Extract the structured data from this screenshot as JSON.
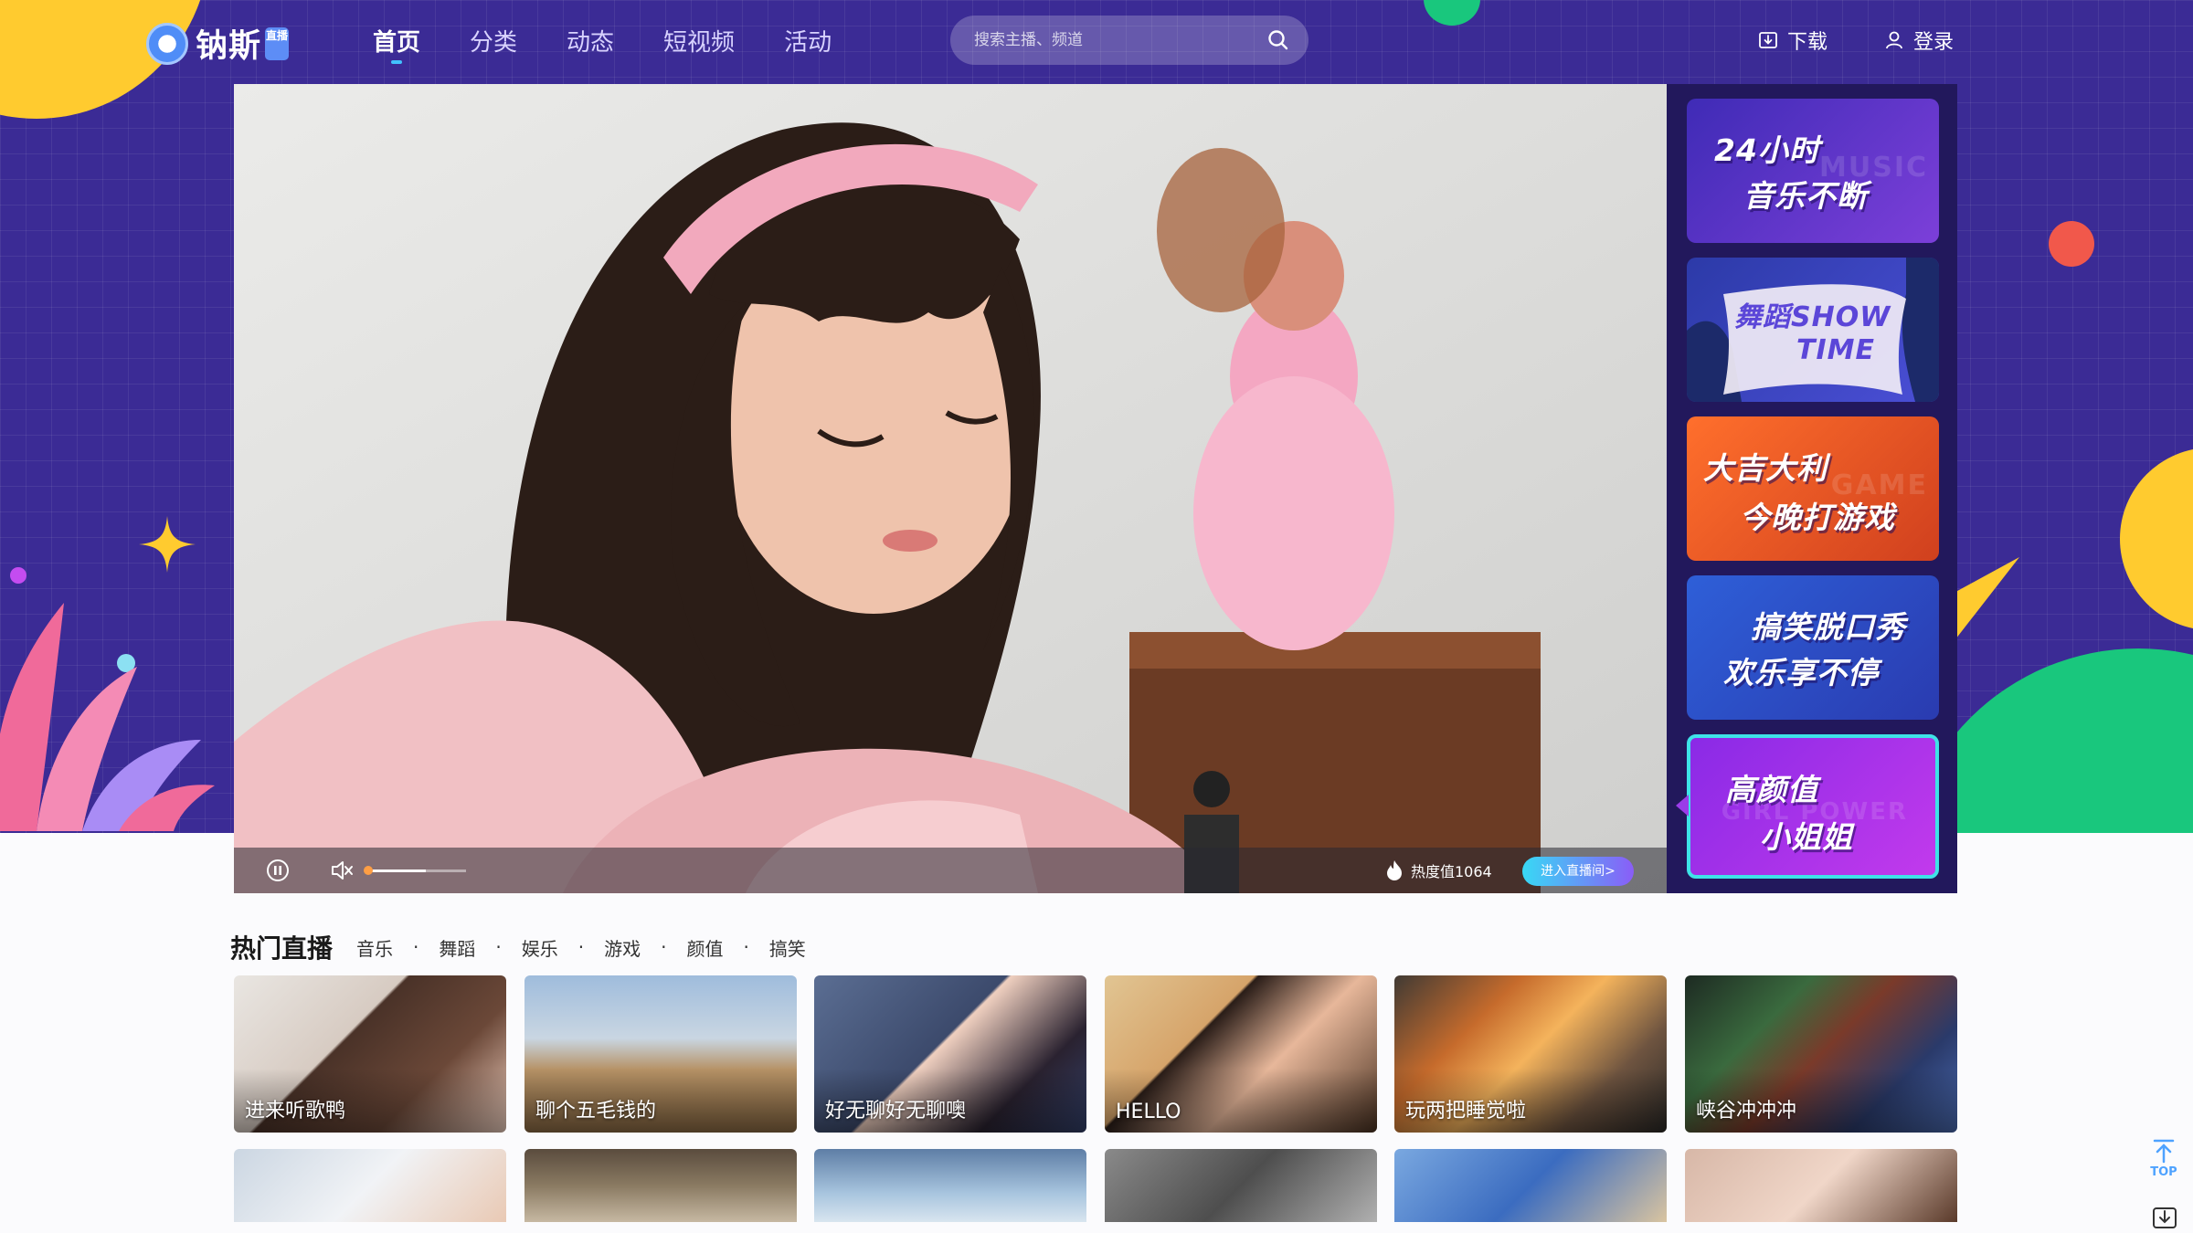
{
  "header": {
    "logo_text": "钠斯",
    "logo_badge": "直播",
    "nav": [
      {
        "label": "首页",
        "active": true
      },
      {
        "label": "分类",
        "active": false
      },
      {
        "label": "动态",
        "active": false
      },
      {
        "label": "短视频",
        "active": false
      },
      {
        "label": "活动",
        "active": false
      }
    ],
    "search_placeholder": "搜索主播、频道",
    "download_label": "下载",
    "login_label": "登录"
  },
  "player": {
    "heat_label": "热度值1064",
    "enter_room_label": "进入直播间>",
    "volume_level": 0.6
  },
  "banners": [
    {
      "line1": "24小时",
      "line2": "音乐不断",
      "bg_word": "MUSIC"
    },
    {
      "line1": "舞蹈SHOW",
      "line2": "TIME",
      "bg_word": ""
    },
    {
      "line1": "大吉大利",
      "line2": "今晚打游戏",
      "bg_word": "GAME"
    },
    {
      "line1": "搞笑脱口秀",
      "line2": "欢乐享不停",
      "bg_word": ""
    },
    {
      "line1": "高颜值",
      "line2": "小姐姐",
      "bg_word": "GIRL POWER"
    }
  ],
  "hot": {
    "title": "热门直播",
    "categories": [
      "音乐",
      "舞蹈",
      "娱乐",
      "游戏",
      "颜值",
      "搞笑"
    ],
    "cards": [
      {
        "label": "进来听歌鸭"
      },
      {
        "label": "聊个五毛钱的"
      },
      {
        "label": "好无聊好无聊噢"
      },
      {
        "label": "HELLO"
      },
      {
        "label": "玩两把睡觉啦"
      },
      {
        "label": "峡谷冲冲冲"
      }
    ]
  },
  "tools": {
    "back_to_top": "TOP"
  },
  "colors": {
    "hero_bg": "#3b2b95",
    "accent_cyan": "#42c2ff",
    "accent_yellow": "#ffcb2f",
    "accent_green": "#19c77d"
  }
}
